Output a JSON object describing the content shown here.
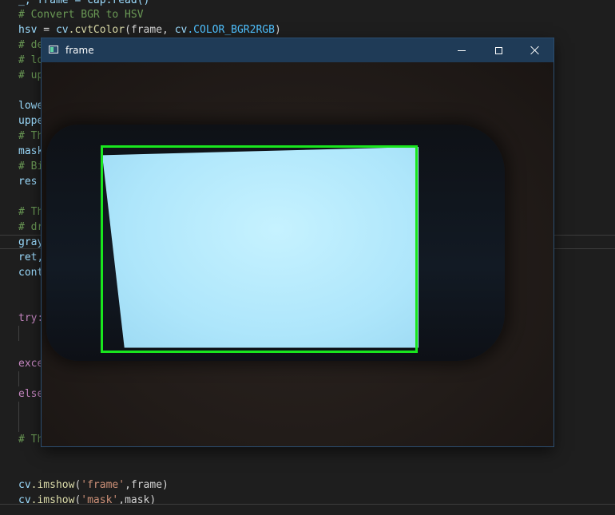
{
  "editor": {
    "lines": {
      "l1": "_, frame = cap.read()",
      "l2": "# Convert BGR to HSV",
      "l3_var": "hsv",
      "l3_eq": " = ",
      "l3_obj": "cv",
      "l3_fn": ".cvtColor",
      "l3_args": "(frame, ",
      "l3_obj2": "cv",
      "l3_const": ".COLOR_BGR2RGB",
      "l3_end": ")",
      "l4": "# de",
      "l5": "# lo",
      "l6": "# up",
      "l7": "lowe",
      "l8": "uppe",
      "l9": "# Th",
      "l10": "mask",
      "l11": "# Bi",
      "l12": "res",
      "l13": "# Th",
      "l14": "# dr",
      "l15": "gray",
      "l16": "ret,",
      "l17": "cont",
      "l18": "try:",
      "l19": "exce",
      "l20": "else",
      "l21": "# Th",
      "l22_obj": "cv",
      "l22_fn": ".imshow",
      "l22_open": "(",
      "l22_str": "'frame'",
      "l22_rest": ",frame)",
      "l23_obj": "cv",
      "l23_fn": ".imshow",
      "l23_open": "(",
      "l23_str": "'mask'",
      "l23_rest": ",mask)"
    }
  },
  "window": {
    "title": "frame",
    "icons": {
      "app": "opencv-window-icon",
      "minimize": "minimize-icon",
      "maximize": "maximize-icon",
      "close": "close-icon"
    }
  },
  "colors": {
    "detection_box": "#19e61e",
    "titlebar": "#1f3b57",
    "editor_bg": "#1e1e1e"
  }
}
